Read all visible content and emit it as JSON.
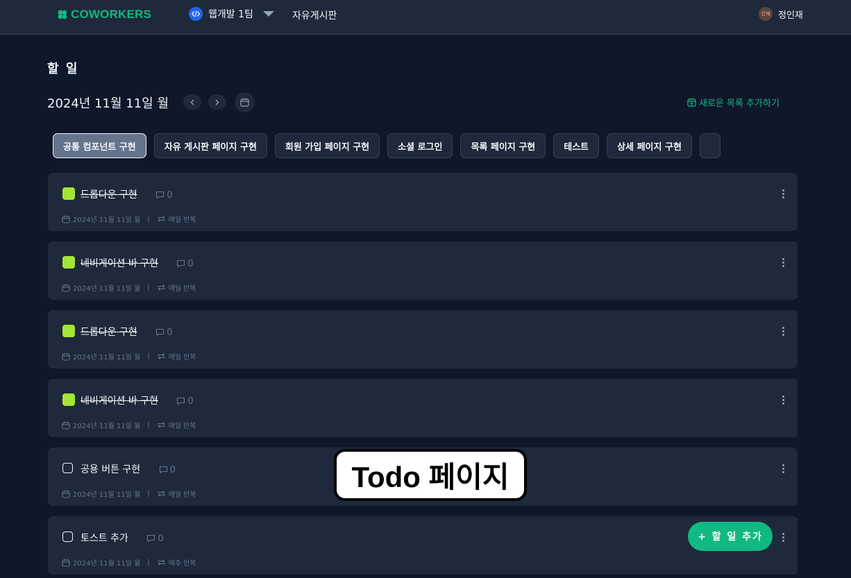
{
  "header": {
    "logo_text": "COWORKERS",
    "team_name": "웹개발 1팀",
    "board_link": "자유게시판",
    "user_name": "정인재",
    "avatar_text": "인재"
  },
  "page": {
    "title": "할 일",
    "date": "2024년 11월 11일 월",
    "add_list_label": "새로운 목록 추가하기"
  },
  "tabs": [
    {
      "label": "공통 컴포넌트 구현",
      "active": true
    },
    {
      "label": "자유 게시판 페이지 구현",
      "active": false
    },
    {
      "label": "회원 가입 페이지 구현",
      "active": false
    },
    {
      "label": "소셜 로그인",
      "active": false
    },
    {
      "label": "목록 페이지 구현",
      "active": false
    },
    {
      "label": "테스트",
      "active": false
    },
    {
      "label": "상세 페이지 구현",
      "active": false
    },
    {
      "label": "",
      "active": false
    }
  ],
  "tasks": [
    {
      "title": "드롭다운 구현",
      "done": true,
      "comments": "0",
      "date": "2024년 11월 11일 월",
      "repeat": "매일 반복"
    },
    {
      "title": "네비게이션 바 구현",
      "done": true,
      "comments": "0",
      "date": "2024년 11월 11일 월",
      "repeat": "매일 반복"
    },
    {
      "title": "드롭다운 구현",
      "done": true,
      "comments": "0",
      "date": "2024년 11월 11일 월",
      "repeat": "매일 반복"
    },
    {
      "title": "네비게이션 바 구현",
      "done": true,
      "comments": "0",
      "date": "2024년 11월 11일 월",
      "repeat": "매일 반복"
    },
    {
      "title": "공용 버튼 구현",
      "done": false,
      "comments": "0",
      "date": "2024년 11월 11일 월",
      "repeat": "매일 반복"
    },
    {
      "title": "토스트 추가",
      "done": false,
      "comments": "0",
      "date": "2024년 11월 11일 월",
      "repeat": "매주 반복"
    }
  ],
  "overlay_label": "Todo 페이지",
  "fab_label": "+ 할 일 추가",
  "colors": {
    "accent": "#10b981",
    "done_check": "#a3e635",
    "background": "#0f172a",
    "card": "#1e293b"
  },
  "icons": {
    "logo": "clover-icon",
    "team": "code-icon",
    "dropdown": "triangle-down-icon",
    "calendar": "calendar-icon",
    "repeat": "repeat-icon",
    "comment": "comment-icon",
    "more": "kebab-icon"
  }
}
